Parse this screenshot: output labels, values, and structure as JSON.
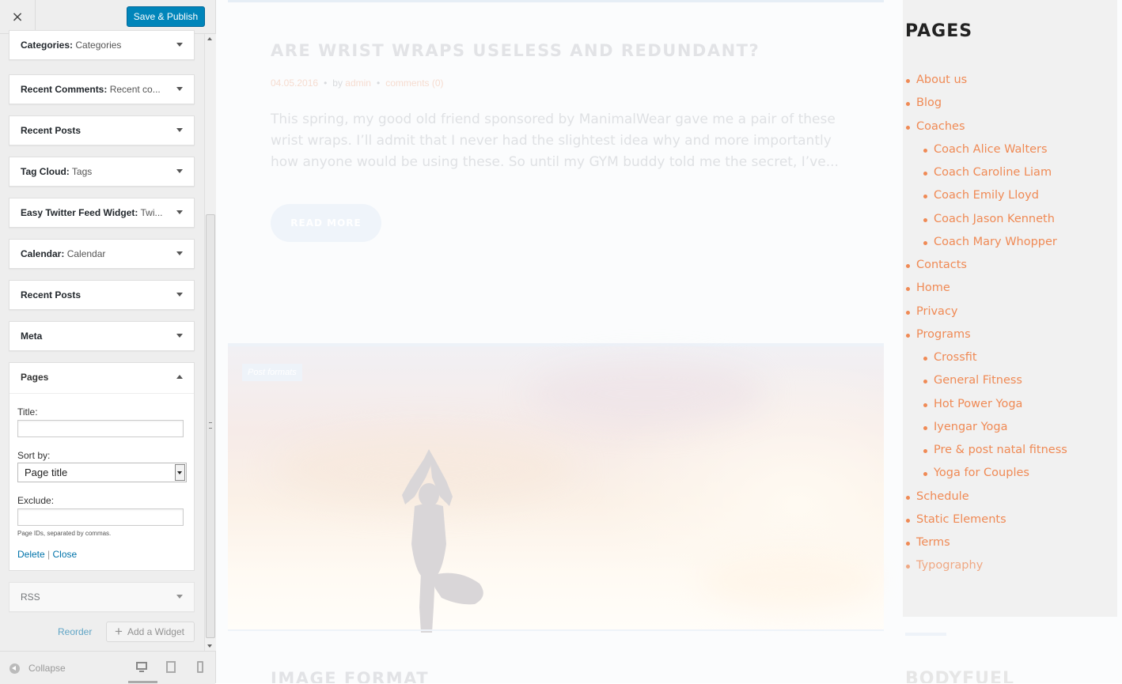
{
  "panel": {
    "close_icon": "×",
    "save_label": "Save & Publish",
    "widgets": [
      {
        "type": "Categories",
        "sub": "Categories"
      },
      {
        "type": "Recent Comments",
        "sub": "Recent co..."
      },
      {
        "type": "Recent Posts",
        "sub": ""
      },
      {
        "type": "Tag Cloud",
        "sub": "Tags"
      },
      {
        "type": "Easy Twitter Feed Widget",
        "sub": "Twi..."
      },
      {
        "type": "Calendar",
        "sub": "Calendar"
      },
      {
        "type": "Recent Posts",
        "sub": ""
      },
      {
        "type": "Meta",
        "sub": ""
      }
    ],
    "pages_widget": {
      "title": "Pages",
      "title_label": "Title:",
      "title_value": "",
      "sort_label": "Sort by:",
      "sort_value": "Page title",
      "exclude_label": "Exclude:",
      "exclude_value": "",
      "exclude_hint": "Page IDs, separated by commas.",
      "delete_label": "Delete",
      "separator": "|",
      "close_label": "Close"
    },
    "rss_label": "RSS",
    "reorder_label": "Reorder",
    "add_widget_label": "Add a Widget",
    "collapse_label": "Collapse",
    "colon": ":"
  },
  "preview": {
    "post": {
      "title": "ARE WRIST WRAPS USELESS AND REDUNDANT?",
      "date": "04.05.2016",
      "by": "by",
      "author": "admin",
      "comments": "comments (0)",
      "excerpt": "This spring, my good old friend sponsored by ManimalWear gave me a pair of these wrist wraps. I’ll admit that I never had the slightest idea why and more importantly how anyone would be using these. So until my GYM buddy told me the secret, I’ve...",
      "read_more": "READ MORE"
    },
    "hero_badge": "Post formats",
    "next_post_title": "IMAGE FORMAT",
    "sidebar": {
      "title": "PAGES",
      "next_title": "BODYFUEL",
      "pages": [
        {
          "label": "About us",
          "level": 0
        },
        {
          "label": "Blog",
          "level": 0
        },
        {
          "label": "Coaches",
          "level": 0
        },
        {
          "label": "Coach Alice Walters",
          "level": 1
        },
        {
          "label": "Coach Caroline Liam",
          "level": 1
        },
        {
          "label": "Coach Emily Lloyd",
          "level": 1
        },
        {
          "label": "Coach Jason Kenneth",
          "level": 1
        },
        {
          "label": "Coach Mary Whopper",
          "level": 1
        },
        {
          "label": "Contacts",
          "level": 0
        },
        {
          "label": "Home",
          "level": 0
        },
        {
          "label": "Privacy",
          "level": 0
        },
        {
          "label": "Programs",
          "level": 0
        },
        {
          "label": "Crossfit",
          "level": 1
        },
        {
          "label": "General Fitness",
          "level": 1
        },
        {
          "label": "Hot Power Yoga",
          "level": 1
        },
        {
          "label": "Iyengar Yoga",
          "level": 1
        },
        {
          "label": "Pre & post natal fitness",
          "level": 1
        },
        {
          "label": "Yoga for Couples",
          "level": 1
        },
        {
          "label": "Schedule",
          "level": 0
        },
        {
          "label": "Static Elements",
          "level": 0
        },
        {
          "label": "Terms",
          "level": 0
        },
        {
          "label": "Typography",
          "level": 0
        }
      ]
    }
  },
  "colors": {
    "primary_button": "#0085ba",
    "link": "#0073aa",
    "accent_orange": "#f08a55"
  }
}
